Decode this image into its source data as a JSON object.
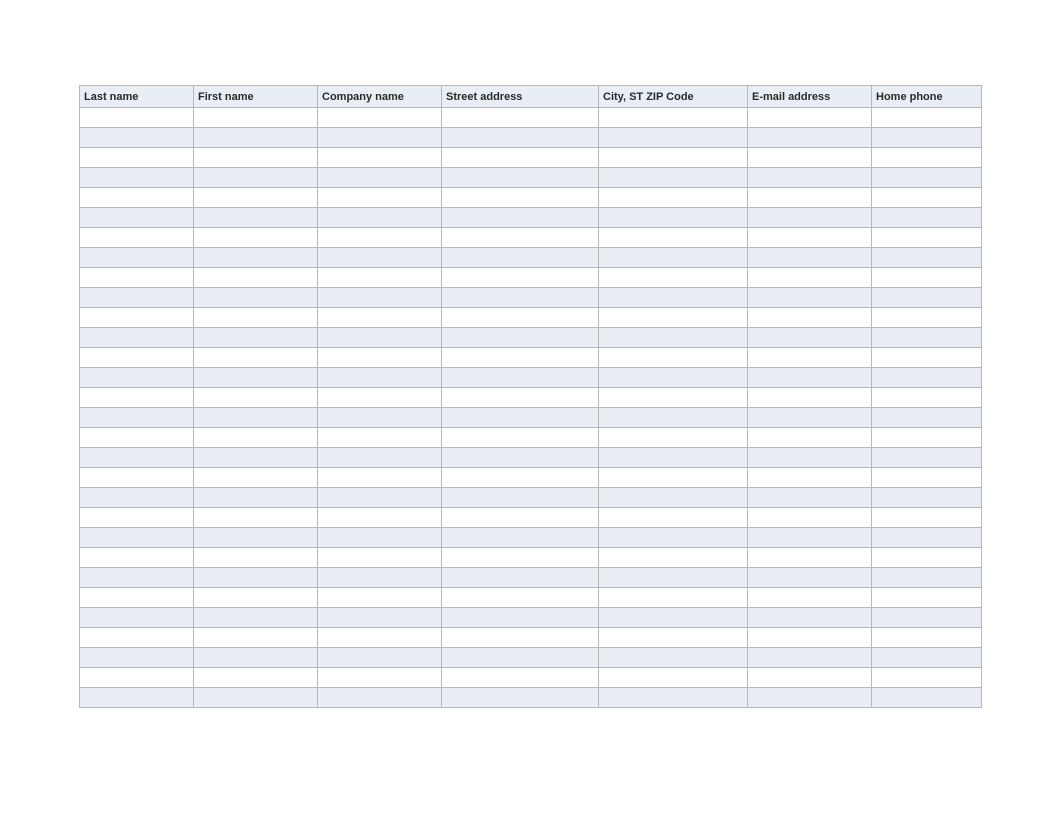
{
  "table": {
    "columns": [
      {
        "key": "last_name",
        "label": "Last name"
      },
      {
        "key": "first_name",
        "label": "First name"
      },
      {
        "key": "company",
        "label": "Company name"
      },
      {
        "key": "street",
        "label": "Street address"
      },
      {
        "key": "city",
        "label": "City, ST  ZIP Code"
      },
      {
        "key": "email",
        "label": "E-mail address"
      },
      {
        "key": "phone",
        "label": "Home phone"
      }
    ],
    "row_count": 30,
    "rows": [
      {},
      {},
      {},
      {},
      {},
      {},
      {},
      {},
      {},
      {},
      {},
      {},
      {},
      {},
      {},
      {},
      {},
      {},
      {},
      {},
      {},
      {},
      {},
      {},
      {},
      {},
      {},
      {},
      {},
      {}
    ]
  },
  "colors": {
    "header_bg": "#e8eef4",
    "stripe_bg": "#e8eef4",
    "border": "#b8b8b8"
  }
}
